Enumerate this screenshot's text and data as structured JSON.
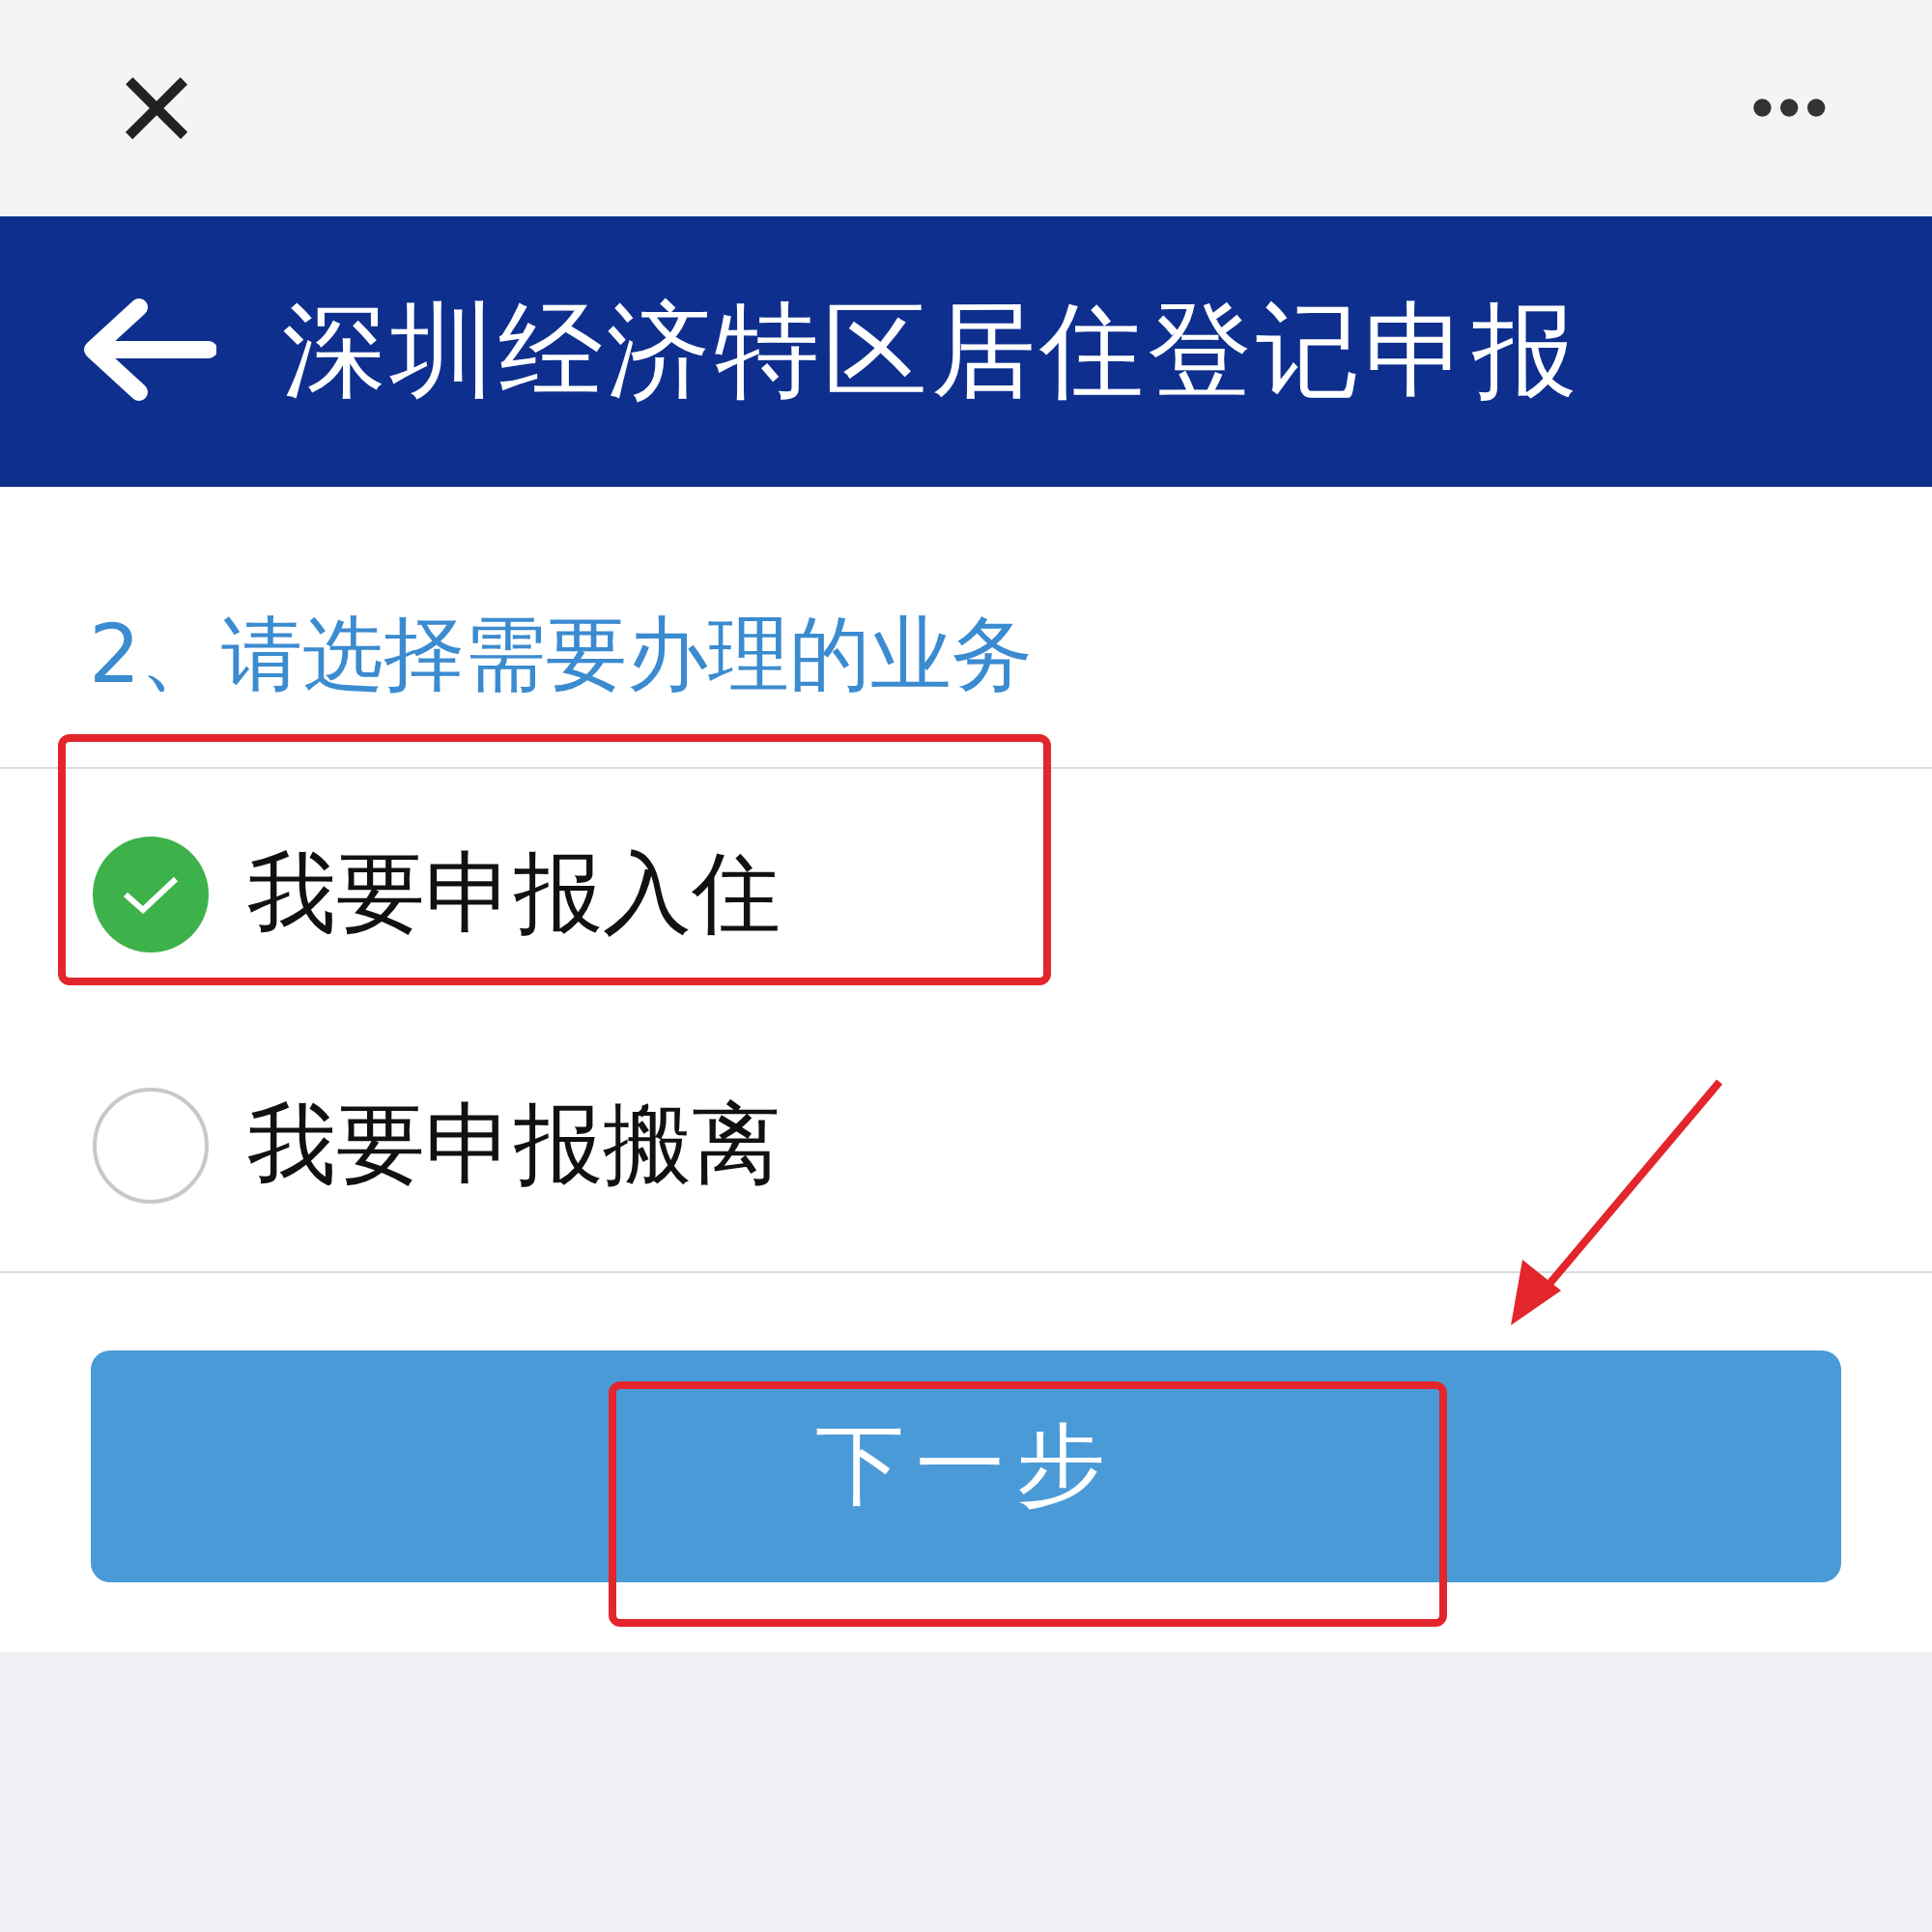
{
  "top_bar": {
    "close": "×",
    "more": "•••"
  },
  "header": {
    "title": "深圳经济特区居住登记申报"
  },
  "section": {
    "title": "2、请选择需要办理的业务"
  },
  "options": [
    {
      "label": "我要申报入住",
      "selected": true
    },
    {
      "label": "我要申报搬离",
      "selected": false
    }
  ],
  "next_button": {
    "label": "下一步"
  }
}
